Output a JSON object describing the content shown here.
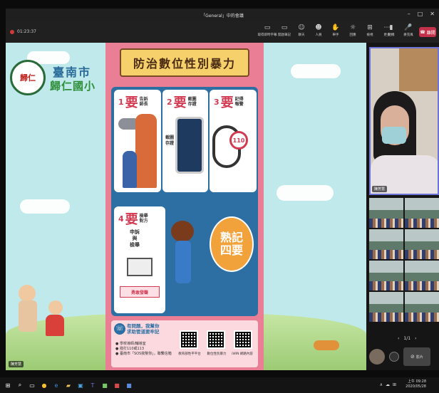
{
  "window": {
    "title": "「General」中的會議",
    "controls": [
      "–",
      "□",
      "✕"
    ]
  },
  "toolbar": {
    "timer": "01:23:37",
    "group1": [
      {
        "icon": "▭",
        "label": "取得即時字幕"
      },
      {
        "icon": "▭",
        "label": "開啟筆記"
      }
    ],
    "group2": [
      {
        "icon": "☺",
        "label": "聊天"
      },
      {
        "icon": "☻",
        "label": "人員"
      },
      {
        "icon": "✋",
        "label": "舉手"
      },
      {
        "icon": "☼",
        "label": "回應"
      },
      {
        "icon": "⊞",
        "label": "檢視"
      },
      {
        "icon": "⋯",
        "label": "更多"
      }
    ],
    "group3": [
      {
        "icon": "▮",
        "label": "相機"
      },
      {
        "icon": "🎤",
        "label": "麥克風"
      },
      {
        "icon": "↑",
        "label": "分享"
      }
    ],
    "leave_label": "離開"
  },
  "poster": {
    "logo_seal": "歸仁",
    "city": "臺南市",
    "school": "歸仁國小",
    "title": "防治數位性別暴力",
    "cards": [
      {
        "num": "1",
        "big": "要",
        "sub": [
          "告訴",
          "師長"
        ]
      },
      {
        "num": "2",
        "big": "要",
        "sub": [
          "截圖",
          "存證"
        ]
      },
      {
        "num": "3",
        "big": "要",
        "sub": [
          "記得",
          "報警"
        ]
      },
      {
        "num": "4",
        "big": "要",
        "sub": [
          "檢舉",
          "對方"
        ]
      }
    ],
    "card2_note": [
      "截圖",
      "存證"
    ],
    "card3_number": "110",
    "card4_lines": [
      "申訴",
      "與",
      "檢舉"
    ],
    "card4_button": "勇敢發聲",
    "bubble_lines": [
      "熟記",
      "四要"
    ],
    "help_lines": [
      "有問題，我幫你",
      "求助管道要牢記"
    ],
    "bullets": [
      "● 學校導師/輔導室",
      "● 撥打110或113",
      "● 臺南市「SOS我幫你」，聯繫信箱"
    ],
    "qr_labels": [
      "教育部性平平台",
      "數位性別暴力",
      "iWIN 網路內容"
    ]
  },
  "participants": {
    "main_name": "陳芳慧",
    "pager": {
      "prev": "‹",
      "page": "1/1",
      "next": "›"
    },
    "video_label": "影片",
    "stage_name": "陳芳慧"
  },
  "taskbar": {
    "time": "上午 09:28",
    "date": "2020/05/28",
    "tray": [
      "∧",
      "☁",
      "⊞"
    ]
  },
  "colors": {
    "poster_pink": "#e97e95",
    "poster_blue": "#2d6fa3",
    "leave_red": "#c4314b",
    "active_border": "#6c74d8"
  }
}
